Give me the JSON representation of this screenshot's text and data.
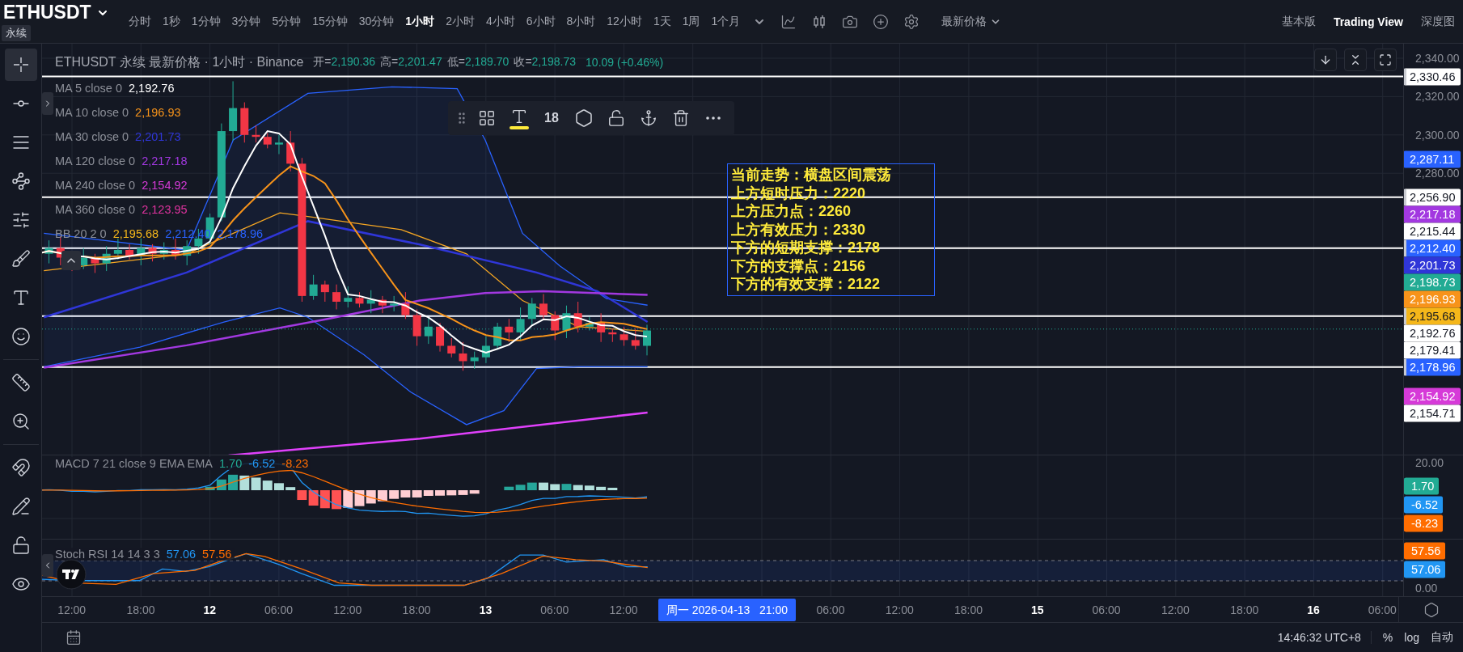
{
  "symbol": {
    "name": "ETHUSDT",
    "badge": "永续"
  },
  "intervals": [
    {
      "label": "分时",
      "selected": false
    },
    {
      "label": "1秒",
      "selected": false
    },
    {
      "label": "1分钟",
      "selected": false
    },
    {
      "label": "3分钟",
      "selected": false
    },
    {
      "label": "5分钟",
      "selected": false
    },
    {
      "label": "15分钟",
      "selected": false
    },
    {
      "label": "30分钟",
      "selected": false
    },
    {
      "label": "1小时",
      "selected": true
    },
    {
      "label": "2小时",
      "selected": false
    },
    {
      "label": "4小时",
      "selected": false
    },
    {
      "label": "6小时",
      "selected": false
    },
    {
      "label": "8小时",
      "selected": false
    },
    {
      "label": "12小时",
      "selected": false
    },
    {
      "label": "1天",
      "selected": false
    },
    {
      "label": "1周",
      "selected": false
    },
    {
      "label": "1个月",
      "selected": false
    }
  ],
  "price_type": "最新价格",
  "views": [
    {
      "label": "基本版",
      "selected": false
    },
    {
      "label": "Trading View",
      "selected": true
    },
    {
      "label": "深度图",
      "selected": false
    }
  ],
  "tool_groups": [
    {
      "tools": [
        {
          "kind": "crosshair",
          "selected": true
        },
        {
          "kind": "trend-line",
          "selected": false
        },
        {
          "kind": "lines",
          "selected": false
        },
        {
          "kind": "pattern",
          "selected": false
        },
        {
          "kind": "fib",
          "selected": false
        },
        {
          "kind": "brush",
          "selected": false
        },
        {
          "kind": "text",
          "selected": false
        },
        {
          "kind": "emoji",
          "selected": false
        }
      ]
    },
    {
      "tools": [
        {
          "kind": "ruler",
          "selected": false
        },
        {
          "kind": "zoom",
          "selected": false
        }
      ]
    },
    {
      "tools": [
        {
          "kind": "magnet",
          "selected": false
        },
        {
          "kind": "lock-drawing",
          "selected": false
        },
        {
          "kind": "lock",
          "selected": false
        },
        {
          "kind": "eye",
          "selected": false
        }
      ]
    }
  ],
  "legend": {
    "title": "ETHUSDT 永续 最新价格 · 1小时 · Binance",
    "ohlc": [
      {
        "label": "开=",
        "value": "2,190.36"
      },
      {
        "label": "高=",
        "value": "2,201.47"
      },
      {
        "label": "低=",
        "value": "2,189.70"
      },
      {
        "label": "收=",
        "value": "2,198.73"
      }
    ],
    "change": "10.09 (+0.46%)"
  },
  "indicators": [
    {
      "name": "MA 5 close 0",
      "values": [
        {
          "text": "2,192.76",
          "color": "#ffffff"
        }
      ]
    },
    {
      "name": "MA 10 close 0",
      "values": [
        {
          "text": "2,196.93",
          "color": "#f7931a"
        }
      ]
    },
    {
      "name": "MA 30 close 0",
      "values": [
        {
          "text": "2,201.73",
          "color": "#2f36d8"
        }
      ]
    },
    {
      "name": "MA 120 close 0",
      "values": [
        {
          "text": "2,217.18",
          "color": "#a238e0"
        }
      ]
    },
    {
      "name": "MA 240 close 0",
      "values": [
        {
          "text": "2,154.92",
          "color": "#d63ad8"
        }
      ]
    },
    {
      "name": "MA 360 close 0",
      "values": [
        {
          "text": "2,123.95",
          "color": "#e0339f"
        }
      ]
    },
    {
      "name": "BB 20 2 0",
      "values": [
        {
          "text": "2,195.68",
          "color": "#f5b71a"
        },
        {
          "text": "2,212.40",
          "color": "#2962ff"
        },
        {
          "text": "2,178.96",
          "color": "#2962ff"
        }
      ]
    }
  ],
  "drawing_toolbar": {
    "font_size": "18"
  },
  "annotation": {
    "lines": [
      "当前走势：横盘区间震荡",
      "上方短时压力：2220",
      "上方压力点：2260",
      "上方有效压力：2330",
      "下方的短期支撑：2178",
      "下方的支撑点：2156",
      "下方的有效支撑：2122"
    ]
  },
  "price_axis": {
    "ticks": [
      "2,340.00",
      "2,320.00",
      "2,300.00",
      "2,280.00"
    ],
    "tags": [
      {
        "text": "2,330.46",
        "color": "#ffffff",
        "line": true
      },
      {
        "text": "2,287.11",
        "color": "#2962ff",
        "line": false
      },
      {
        "text": "2,256.90",
        "color": "#ffffff",
        "line": true
      },
      {
        "text": "2,217.18",
        "color": "#a238e0",
        "line": false
      },
      {
        "text": "2,215.44",
        "color": "#ffffff",
        "line": false
      },
      {
        "text": "2,212.40",
        "color": "#2962ff",
        "line": true
      },
      {
        "text": "2,201.73",
        "color": "#2f36d8",
        "line": false
      },
      {
        "text": "2,198.73",
        "color": "#22ab94",
        "line": false
      },
      {
        "text": "2,196.93",
        "color": "#f7931a",
        "line": false
      },
      {
        "text": "2,195.68",
        "color": "#f5b71a",
        "line": true
      },
      {
        "text": "2,192.76",
        "color": "#ffffff",
        "line": false
      },
      {
        "text": "2,179.41",
        "color": "#ffffff",
        "line": false
      },
      {
        "text": "2,178.96",
        "color": "#2962ff",
        "line": true
      },
      {
        "text": "2,154.92",
        "color": "#d63ad8",
        "line": false
      },
      {
        "text": "2,154.71",
        "color": "#ffffff",
        "line": false
      }
    ]
  },
  "macd": {
    "name": "MACD 7 21 close 9 EMA EMA",
    "values": [
      {
        "text": "1.70",
        "color": "#22ab94"
      },
      {
        "text": "-6.52",
        "color": "#2196f3"
      },
      {
        "text": "-8.23",
        "color": "#ff6d00"
      }
    ],
    "tick": "20.00",
    "tags": [
      {
        "text": "1.70",
        "color": "#22ab94"
      },
      {
        "text": "-6.52",
        "color": "#2196f3"
      },
      {
        "text": "-8.23",
        "color": "#ff6d00"
      }
    ]
  },
  "stoch_rsi": {
    "name": "Stoch RSI 14 14 3 3",
    "values": [
      {
        "text": "57.06",
        "color": "#2196f3"
      },
      {
        "text": "57.56",
        "color": "#ff6d00"
      }
    ],
    "tick": "0.00",
    "tags": [
      {
        "text": "57.56",
        "color": "#ff6d00"
      },
      {
        "text": "57.06",
        "color": "#2196f3"
      }
    ]
  },
  "time_axis": [
    {
      "kind": "tick",
      "text": "12:00",
      "bold": false
    },
    {
      "kind": "tick",
      "text": "18:00",
      "bold": false
    },
    {
      "kind": "tick",
      "text": "12",
      "bold": true
    },
    {
      "kind": "tick",
      "text": "06:00",
      "bold": false
    },
    {
      "kind": "tick",
      "text": "12:00",
      "bold": false
    },
    {
      "kind": "tick",
      "text": "18:00",
      "bold": false
    },
    {
      "kind": "tick",
      "text": "13",
      "bold": true
    },
    {
      "kind": "tick",
      "text": "06:00",
      "bold": false
    },
    {
      "kind": "tick",
      "text": "12:00",
      "bold": false
    },
    {
      "kind": "cursor",
      "text": "周一 2026-04-13   21:00"
    },
    {
      "kind": "tick",
      "text": "06:00",
      "bold": false
    },
    {
      "kind": "tick",
      "text": "12:00",
      "bold": false
    },
    {
      "kind": "tick",
      "text": "18:00",
      "bold": false
    },
    {
      "kind": "tick",
      "text": "15",
      "bold": true
    },
    {
      "kind": "tick",
      "text": "06:00",
      "bold": false
    },
    {
      "kind": "tick",
      "text": "12:00",
      "bold": false
    },
    {
      "kind": "tick",
      "text": "18:00",
      "bold": false
    },
    {
      "kind": "tick",
      "text": "16",
      "bold": true
    },
    {
      "kind": "tick",
      "text": "06:00",
      "bold": false
    }
  ],
  "status_bar": {
    "clock": "14:46:32 UTC+8",
    "options": [
      "%",
      "log",
      "自动"
    ]
  }
}
